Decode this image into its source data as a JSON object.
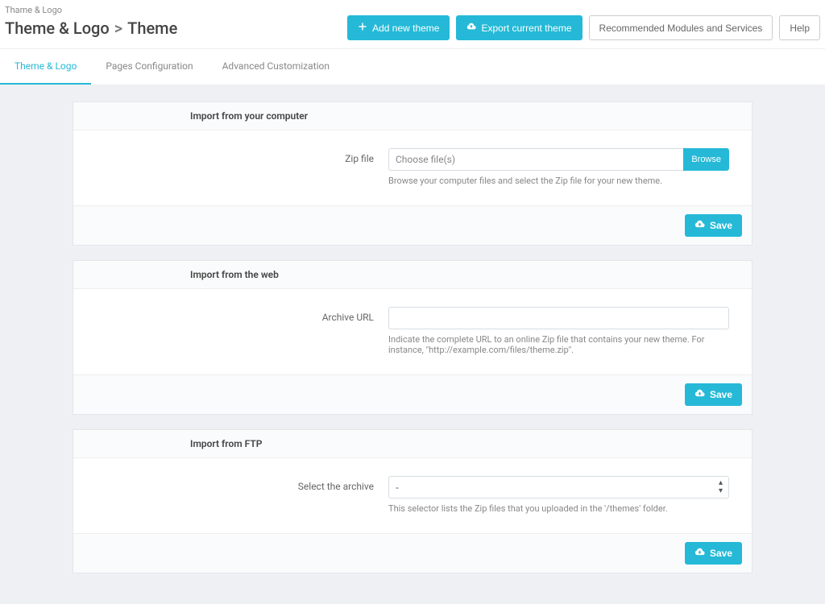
{
  "breadcrumb": "Thame & Logo",
  "title": {
    "section": "Theme & Logo",
    "separator": ">",
    "page": "Theme"
  },
  "header_buttons": {
    "add": "Add new theme",
    "export": "Export current theme",
    "recommended": "Recommended Modules and Services",
    "help": "Help"
  },
  "tabs": [
    {
      "label": "Theme & Logo",
      "active": true
    },
    {
      "label": "Pages Configuration",
      "active": false
    },
    {
      "label": "Advanced Customization",
      "active": false
    }
  ],
  "panels": {
    "computer": {
      "heading": "Import from your computer",
      "label": "Zip file",
      "placeholder": "Choose file(s)",
      "browse": "Browse",
      "hint": "Browse your computer files and select the Zip file for your new theme.",
      "save": "Save"
    },
    "web": {
      "heading": "Import from the web",
      "label": "Archive URL",
      "hint": "Indicate the complete URL to an online Zip file that contains your new theme. For instance, \"http://example.com/files/theme.zip\".",
      "save": "Save"
    },
    "ftp": {
      "heading": "Import from FTP",
      "label": "Select the archive",
      "option_blank": "-",
      "hint": "This selector lists the Zip files that you uploaded in the '/themes' folder.",
      "save": "Save"
    }
  }
}
